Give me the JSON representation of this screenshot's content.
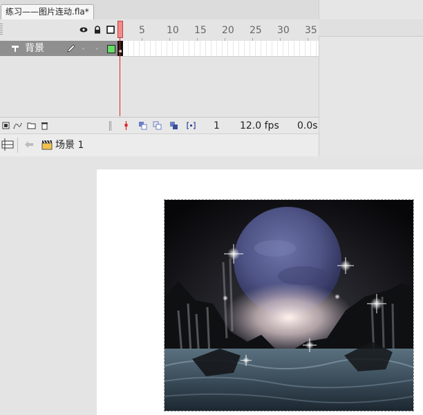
{
  "document": {
    "tab_title": "练习——图片连动.fla*"
  },
  "timeline": {
    "ruler": [
      "5",
      "10",
      "15",
      "20",
      "25",
      "30",
      "35"
    ],
    "layer": {
      "name": "背景",
      "outline_color": "#66dd66"
    },
    "current_frame": "1",
    "frame_rate": "12.0 fps",
    "elapsed": "0.0s",
    "playhead_color": "#f28a8a"
  },
  "editbar": {
    "scene": "场景 1"
  },
  "icons": {
    "eye": "eye-icon",
    "lock": "lock-icon",
    "outline": "outline-square-icon",
    "layer": "layer-icon",
    "pencil": "pencil-icon",
    "scene": "clapperboard-icon"
  }
}
